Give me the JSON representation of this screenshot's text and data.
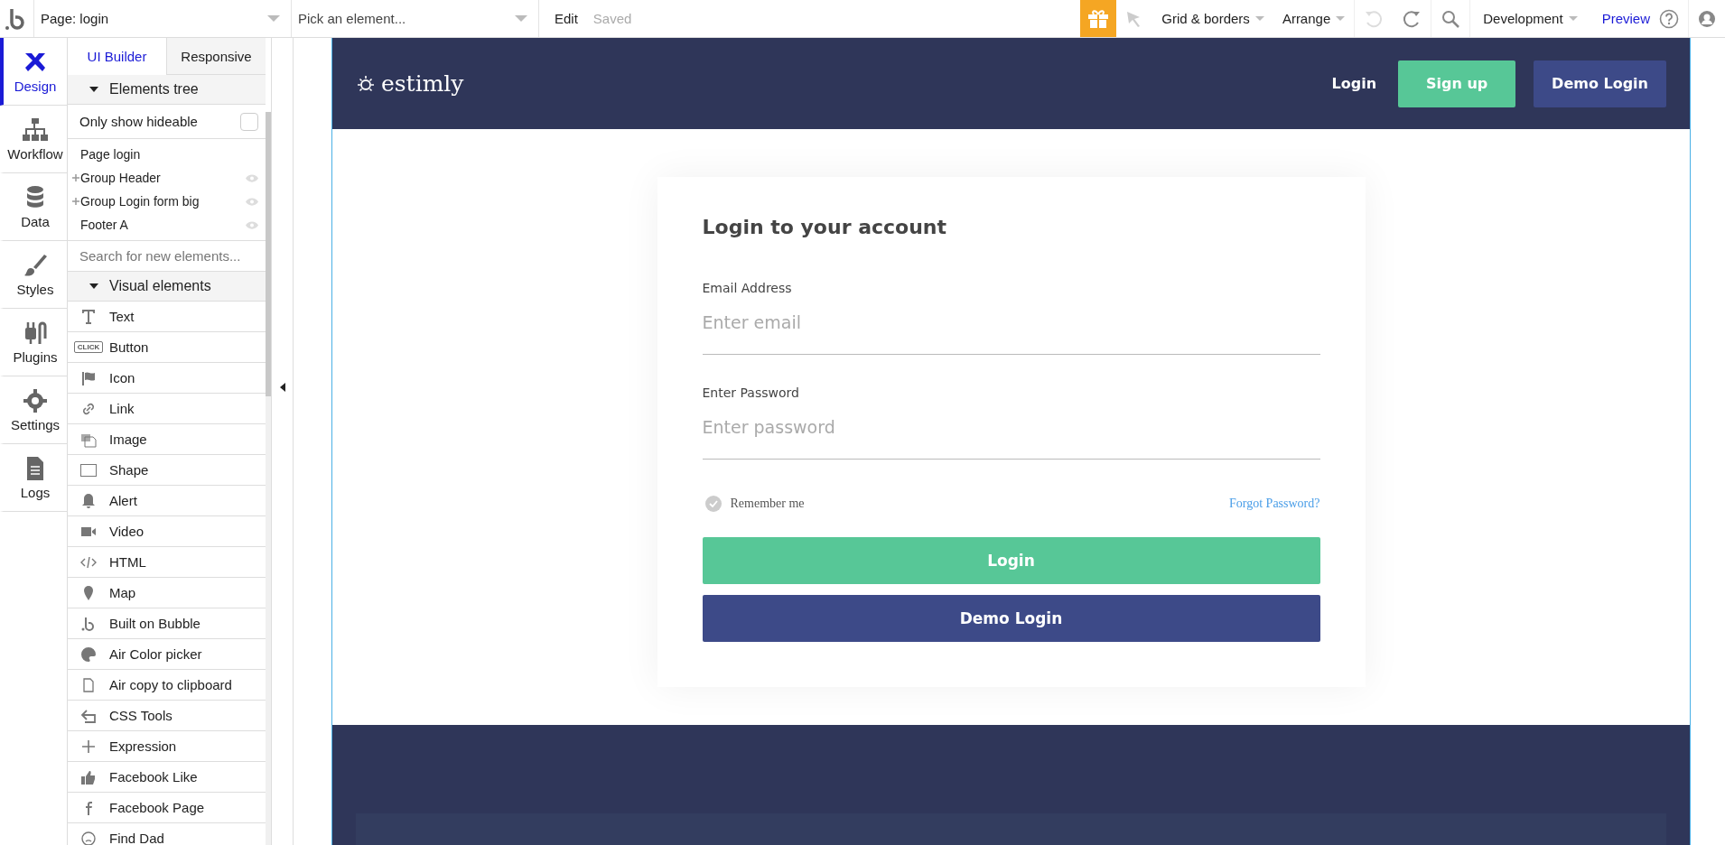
{
  "topbar": {
    "page_selector": "Page: login",
    "element_picker": {
      "placeholder": "Pick an element..."
    },
    "edit_menu": "Edit",
    "save_status": "Saved",
    "grid_menu": "Grid & borders",
    "arrange_menu": "Arrange",
    "environment": "Development",
    "preview": "Preview"
  },
  "nav": [
    {
      "label": "Design",
      "selected": true
    },
    {
      "label": "Workflow",
      "selected": false
    },
    {
      "label": "Data",
      "selected": false
    },
    {
      "label": "Styles",
      "selected": false
    },
    {
      "label": "Plugins",
      "selected": false
    },
    {
      "label": "Settings",
      "selected": false
    },
    {
      "label": "Logs",
      "selected": false
    }
  ],
  "panel_tabs": [
    {
      "label": "UI Builder",
      "selected": true
    },
    {
      "label": "Responsive",
      "selected": false
    }
  ],
  "elements_tree": {
    "title": "Elements tree",
    "filter": {
      "label": "Only show hideable",
      "checked": false
    },
    "items": [
      {
        "label": "Page login",
        "expandable": false,
        "eye": false
      },
      {
        "label": "Group Header",
        "expandable": true,
        "eye": true
      },
      {
        "label": "Group Login form big",
        "expandable": true,
        "eye": true
      },
      {
        "label": "Footer A",
        "expandable": false,
        "eye": true
      }
    ]
  },
  "element_search": {
    "placeholder": "Search for new elements..."
  },
  "visual_elements": {
    "title": "Visual elements",
    "items": [
      "Text",
      "Button",
      "Icon",
      "Link",
      "Image",
      "Shape",
      "Alert",
      "Video",
      "HTML",
      "Map",
      "Built on Bubble",
      "Air Color picker",
      "Air copy to clipboard",
      "CSS Tools",
      "Expression",
      "Facebook Like",
      "Facebook Page",
      "Find Dad"
    ],
    "button_icon_text": "CLICK"
  },
  "canvas": {
    "header": {
      "logo": "estimly",
      "login_link": "Login",
      "signup_button": "Sign up",
      "demo_button": "Demo Login"
    },
    "form": {
      "title": "Login to your account",
      "fields": [
        {
          "label": "Email Address",
          "placeholder": "Enter email"
        },
        {
          "label": "Enter Password",
          "placeholder": "Enter password"
        }
      ],
      "remember": {
        "label": "Remember me",
        "checked": false
      },
      "forgot_link": "Forgot Password?",
      "login_button": "Login",
      "demo_button": "Demo Login"
    }
  }
}
